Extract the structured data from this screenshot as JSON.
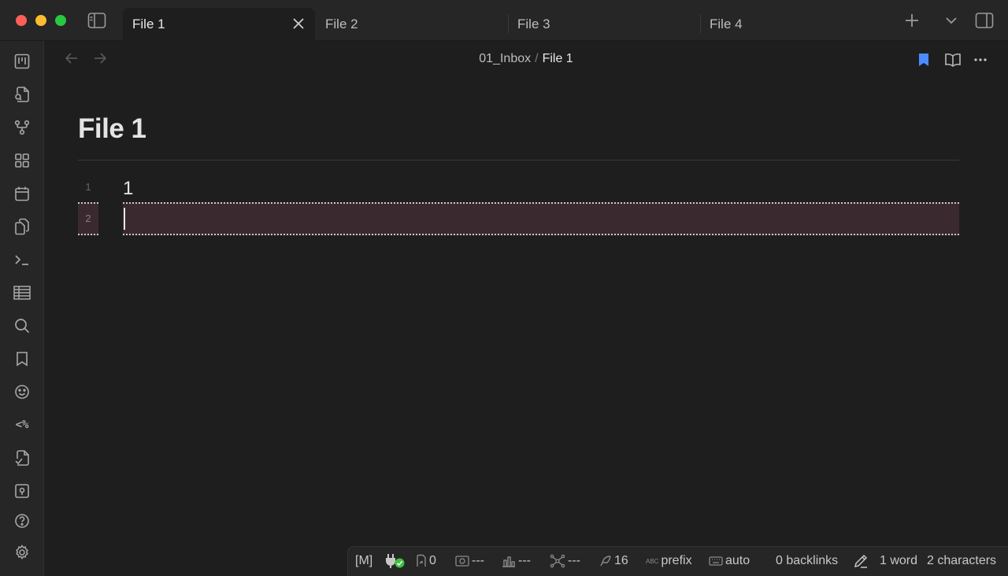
{
  "window": {
    "tabs": [
      {
        "label": "File 1",
        "active": true
      },
      {
        "label": "File 2",
        "active": false
      },
      {
        "label": "File 3",
        "active": false
      },
      {
        "label": "File 4",
        "active": false
      }
    ]
  },
  "navbar": {
    "breadcrumb_folder": "01_Inbox",
    "breadcrumb_sep": "/",
    "breadcrumb_file": "File 1"
  },
  "note": {
    "title": "File 1",
    "lines": [
      {
        "number": "1",
        "text": "1"
      },
      {
        "number": "2",
        "text": ""
      }
    ]
  },
  "statusbar": {
    "mode": "[M]",
    "sync_count": "0",
    "stat1": "---",
    "stat2": "---",
    "stat3": "---",
    "count": "16",
    "prefix_badge": "ABC",
    "prefix": "prefix",
    "auto": "auto",
    "backlinks": "0 backlinks",
    "words": "1 word",
    "characters": "2 characters"
  },
  "colors": {
    "accent_bookmark": "#4a8cff",
    "active_line_bg": "#3a2a30",
    "sync_ok": "#3ec23e"
  }
}
